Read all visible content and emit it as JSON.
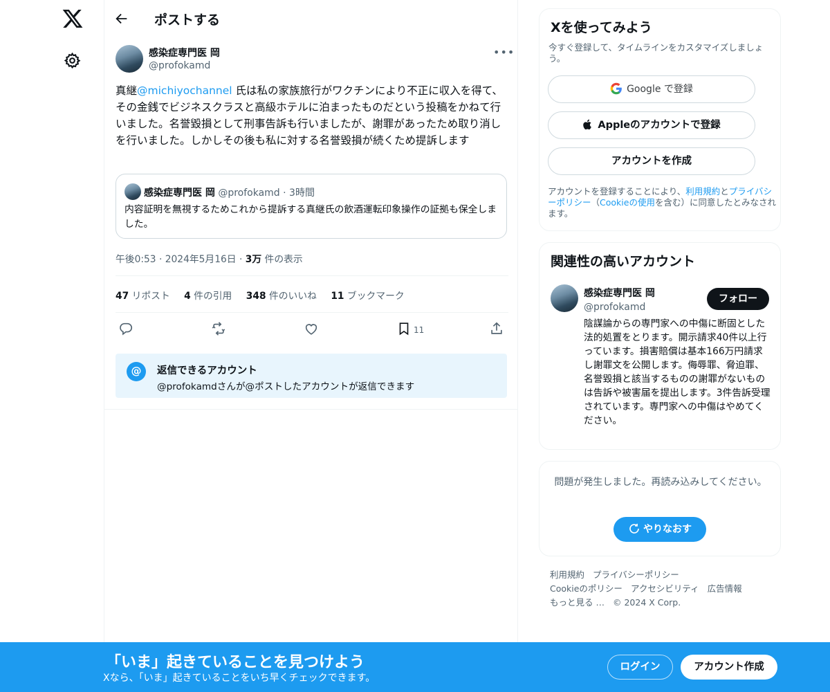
{
  "nav": {
    "logo_icon": "x-logo-icon",
    "settings_icon": "gear-icon"
  },
  "header": {
    "back_icon": "arrow-left-icon",
    "title": "ポストする"
  },
  "post": {
    "author_name": "感染症専門医 岡",
    "author_handle": "@profokamd",
    "more_icon": "more-horizontal-icon",
    "body_prefix": "真継",
    "body_mention": "@michiyochannel",
    "body_suffix": " 氏は私の家族旅行がワクチンにより不正に収入を得て、その金銭でビジネスクラスと高級ホテルに泊まったものだという投稿をかねて行いました。名誉毀損として刑事告訴も行いましたが、謝罪があったため取り消しを行いました。しかしその後も私に対する名誉毀損が続くため提訴します",
    "quote": {
      "author_name": "感染症専門医 岡",
      "author_handle": "@profokamd",
      "time": "3時間",
      "text": "内容証明を無視するためこれから提訴する真継氏の飲酒運転印象操作の証拠も保全しました。"
    },
    "timestamp": "午後0:53 · 2024年5月16日 · ",
    "views_count": "3万",
    "views_label": " 件の表示",
    "stats": [
      {
        "count": "47",
        "label": " リポスト"
      },
      {
        "count": "4",
        "label": " 件の引用"
      },
      {
        "count": "348",
        "label": " 件のいいね"
      },
      {
        "count": "11",
        "label": " ブックマーク"
      }
    ],
    "actions": {
      "reply_icon": "reply-icon",
      "repost_icon": "repost-icon",
      "like_icon": "heart-icon",
      "bookmark_icon": "bookmark-icon",
      "bookmark_count": "11",
      "share_icon": "share-icon"
    },
    "reply_restriction": {
      "icon": "at-sign-icon",
      "icon_text": "@",
      "title": "返信できるアカウント",
      "desc": "@profokamdさんが@ポストしたアカウントが返信できます"
    }
  },
  "signup_card": {
    "title": "Xを使ってみよう",
    "subtitle": "今すぐ登録して、タイムラインをカスタマイズしましょう。",
    "google_label": "Google で登録",
    "apple_label": "Appleのアカウントで登録",
    "create_label": "アカウントを作成",
    "legal_1": "アカウントを登録することにより、",
    "legal_terms": "利用規約",
    "legal_2": "と",
    "legal_privacy": "プライバシーポリシー",
    "legal_3": "（",
    "legal_cookie": "Cookieの使用",
    "legal_4": "を含む）に同意したとみなされます。"
  },
  "related_card": {
    "title": "関連性の高いアカウント",
    "name": "感染症専門医 岡",
    "handle": "@profokamd",
    "follow_label": "フォロー",
    "bio": "陰謀論からの専門家への中傷に断固とした法的処置をとります。開示請求40件以上行っています。損害賠償は基本166万円請求し謝罪文を公開します。侮辱罪、脅迫罪、名誉毀損と該当するものの謝罪がないものは告訴や被害届を提出します。3件告訴受理されています。専門家への中傷はやめてください。"
  },
  "error_card": {
    "message": "問題が発生しました。再読み込みしてください。",
    "retry_label": "やりなおす",
    "retry_icon": "refresh-icon"
  },
  "footer": {
    "links": [
      "利用規約",
      "プライバシーポリシー",
      "Cookieのポリシー",
      "アクセシビリティ",
      "広告情報",
      "もっと見る …",
      "© 2024 X Corp."
    ]
  },
  "banner": {
    "title": "「いま」起きていることを見つけよう",
    "subtitle": "Xなら、「いま」起きていることをいち早くチェックできます。",
    "login_label": "ログイン",
    "signup_label": "アカウント作成"
  },
  "colors": {
    "accent": "#1d9bf0",
    "text": "#0f1419",
    "muted": "#536471",
    "border": "#eff3f4"
  }
}
